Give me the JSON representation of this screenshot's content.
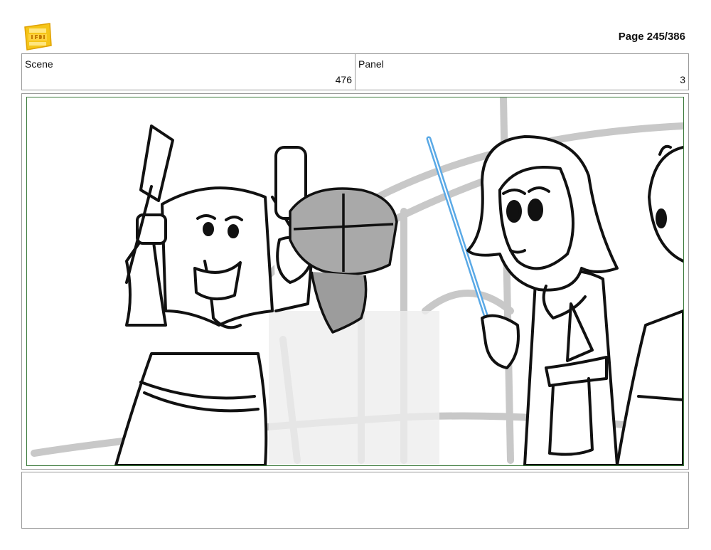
{
  "header": {
    "logo_icon": "young-jedi-adventures-logo",
    "page_label": "Page 245/386"
  },
  "info": {
    "scene_label": "Scene",
    "scene_value": "476",
    "panel_label": "Panel",
    "panel_value": "3"
  },
  "panel": {
    "frame_color": "#3b7a3b",
    "lightsaber_color": "#5aa9e6"
  },
  "notes": {
    "text": ""
  }
}
